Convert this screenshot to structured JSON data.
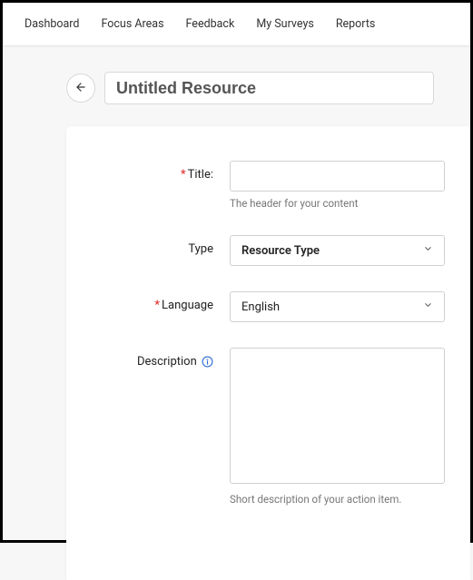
{
  "nav": {
    "items": [
      {
        "label": "Dashboard"
      },
      {
        "label": "Focus Areas"
      },
      {
        "label": "Feedback"
      },
      {
        "label": "My Surveys"
      },
      {
        "label": "Reports"
      }
    ]
  },
  "header": {
    "title_value": "Untitled Resource"
  },
  "form": {
    "title": {
      "label": "Title:",
      "helper": "The header for your content",
      "value": ""
    },
    "type": {
      "label": "Type",
      "selected": "Resource Type"
    },
    "language": {
      "label": "Language",
      "selected": "English"
    },
    "description": {
      "label": "Description",
      "helper": "Short description of your action item.",
      "value": ""
    }
  }
}
